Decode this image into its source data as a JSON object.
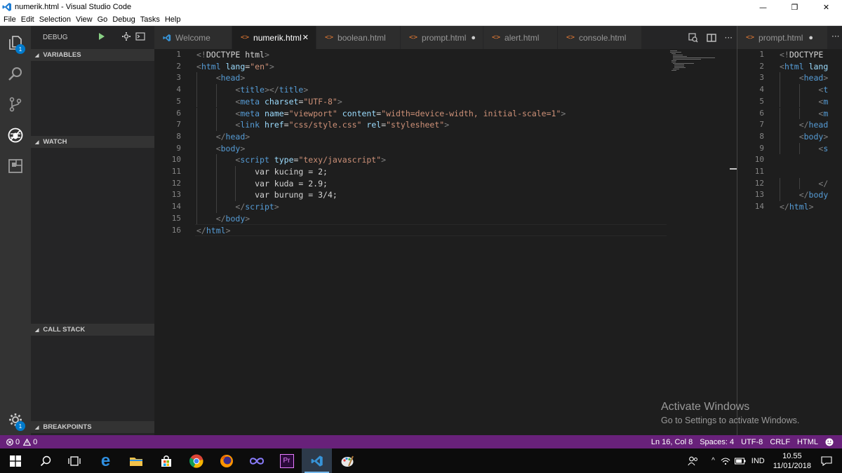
{
  "window": {
    "title": "numerik.html - Visual Studio Code",
    "controls": [
      "—",
      "❐",
      "✕"
    ]
  },
  "menu": [
    "File",
    "Edit",
    "Selection",
    "View",
    "Go",
    "Debug",
    "Tasks",
    "Help"
  ],
  "activity_bar": {
    "items": [
      "explorer-icon",
      "search-icon",
      "source-control-icon",
      "debug-icon",
      "extensions-icon"
    ],
    "explorer_badge": "1",
    "settings_badge": "1"
  },
  "sidebar": {
    "title": "DEBUG",
    "sections": {
      "variables": "VARIABLES",
      "watch": "WATCH",
      "call_stack": "CALL STACK",
      "breakpoints": "BREAKPOINTS"
    }
  },
  "tabs": [
    {
      "label": "Welcome",
      "icon": "vscode-icon",
      "active": false,
      "status": ""
    },
    {
      "label": "numerik.html",
      "icon": "<>",
      "active": true,
      "status": "✕"
    },
    {
      "label": "boolean.html",
      "icon": "<>",
      "active": false,
      "status": ""
    },
    {
      "label": "prompt.html",
      "icon": "<>",
      "active": false,
      "status": "●"
    },
    {
      "label": "alert.html",
      "icon": "<>",
      "active": false,
      "status": ""
    },
    {
      "label": "console.html",
      "icon": "<>",
      "active": false,
      "status": ""
    }
  ],
  "editor": {
    "lines": [
      {
        "n": "1",
        "indent": 0,
        "tokens": [
          [
            "br",
            "<!"
          ],
          [
            "txt",
            "DOCTYPE html"
          ],
          [
            "br",
            ">"
          ]
        ]
      },
      {
        "n": "2",
        "indent": 0,
        "tokens": [
          [
            "br",
            "<"
          ],
          [
            "tag",
            "html"
          ],
          [
            "txt",
            " "
          ],
          [
            "attr",
            "lang"
          ],
          [
            "txt",
            "="
          ],
          [
            "str",
            "\"en\""
          ],
          [
            "br",
            ">"
          ]
        ]
      },
      {
        "n": "3",
        "indent": 1,
        "tokens": [
          [
            "br",
            "<"
          ],
          [
            "tag",
            "head"
          ],
          [
            "br",
            ">"
          ]
        ]
      },
      {
        "n": "4",
        "indent": 2,
        "tokens": [
          [
            "br",
            "<"
          ],
          [
            "tag",
            "title"
          ],
          [
            "br",
            "></"
          ],
          [
            "tag",
            "title"
          ],
          [
            "br",
            ">"
          ]
        ]
      },
      {
        "n": "5",
        "indent": 2,
        "tokens": [
          [
            "br",
            "<"
          ],
          [
            "tag",
            "meta"
          ],
          [
            "txt",
            " "
          ],
          [
            "attr",
            "charset"
          ],
          [
            "txt",
            "="
          ],
          [
            "str",
            "\"UTF-8\""
          ],
          [
            "br",
            ">"
          ]
        ]
      },
      {
        "n": "6",
        "indent": 2,
        "tokens": [
          [
            "br",
            "<"
          ],
          [
            "tag",
            "meta"
          ],
          [
            "txt",
            " "
          ],
          [
            "attr",
            "name"
          ],
          [
            "txt",
            "="
          ],
          [
            "str",
            "\"viewport\""
          ],
          [
            "txt",
            " "
          ],
          [
            "attr",
            "content"
          ],
          [
            "txt",
            "="
          ],
          [
            "str",
            "\"width=device-width, initial-scale=1\""
          ],
          [
            "br",
            ">"
          ]
        ]
      },
      {
        "n": "7",
        "indent": 2,
        "tokens": [
          [
            "br",
            "<"
          ],
          [
            "tag",
            "link"
          ],
          [
            "txt",
            " "
          ],
          [
            "attr",
            "href"
          ],
          [
            "txt",
            "="
          ],
          [
            "str",
            "\"css/style.css\""
          ],
          [
            "txt",
            " "
          ],
          [
            "attr",
            "rel"
          ],
          [
            "txt",
            "="
          ],
          [
            "str",
            "\"stylesheet\""
          ],
          [
            "br",
            ">"
          ]
        ]
      },
      {
        "n": "8",
        "indent": 1,
        "tokens": [
          [
            "br",
            "</"
          ],
          [
            "tag",
            "head"
          ],
          [
            "br",
            ">"
          ]
        ]
      },
      {
        "n": "9",
        "indent": 1,
        "tokens": [
          [
            "br",
            "<"
          ],
          [
            "tag",
            "body"
          ],
          [
            "br",
            ">"
          ]
        ]
      },
      {
        "n": "10",
        "indent": 2,
        "tokens": [
          [
            "br",
            "<"
          ],
          [
            "tag",
            "script"
          ],
          [
            "txt",
            " "
          ],
          [
            "attr",
            "type"
          ],
          [
            "txt",
            "="
          ],
          [
            "str",
            "\"texy/javascript\""
          ],
          [
            "br",
            ">"
          ]
        ]
      },
      {
        "n": "11",
        "indent": 3,
        "tokens": [
          [
            "txt",
            "var kucing = 2;"
          ]
        ]
      },
      {
        "n": "12",
        "indent": 3,
        "tokens": [
          [
            "txt",
            "var kuda = 2.9;"
          ]
        ]
      },
      {
        "n": "13",
        "indent": 3,
        "tokens": [
          [
            "txt",
            "var burung = 3/4;"
          ]
        ]
      },
      {
        "n": "14",
        "indent": 2,
        "tokens": [
          [
            "br",
            "</"
          ],
          [
            "tag",
            "script"
          ],
          [
            "br",
            ">"
          ]
        ]
      },
      {
        "n": "15",
        "indent": 1,
        "tokens": [
          [
            "br",
            "</"
          ],
          [
            "tag",
            "body"
          ],
          [
            "br",
            ">"
          ]
        ]
      },
      {
        "n": "16",
        "indent": 0,
        "tokens": [
          [
            "br",
            "</"
          ],
          [
            "tag",
            "html"
          ],
          [
            "br",
            ">"
          ]
        ]
      }
    ]
  },
  "right_group": {
    "tab_label": "prompt.html",
    "tab_status": "●",
    "lines": [
      {
        "n": "1",
        "indent": 0,
        "tokens": [
          [
            "br",
            "<!"
          ],
          [
            "txt",
            "DOCTYPE"
          ]
        ]
      },
      {
        "n": "2",
        "indent": 0,
        "tokens": [
          [
            "br",
            "<"
          ],
          [
            "tag",
            "html"
          ],
          [
            "txt",
            " "
          ],
          [
            "attr",
            "lang"
          ]
        ]
      },
      {
        "n": "3",
        "indent": 1,
        "tokens": [
          [
            "br",
            "<"
          ],
          [
            "tag",
            "head"
          ],
          [
            "br",
            ">"
          ]
        ]
      },
      {
        "n": "4",
        "indent": 2,
        "tokens": [
          [
            "br",
            "<"
          ],
          [
            "tag",
            "t"
          ]
        ]
      },
      {
        "n": "5",
        "indent": 2,
        "tokens": [
          [
            "br",
            "<"
          ],
          [
            "tag",
            "m"
          ]
        ]
      },
      {
        "n": "6",
        "indent": 2,
        "tokens": [
          [
            "br",
            "<"
          ],
          [
            "tag",
            "m"
          ]
        ]
      },
      {
        "n": "7",
        "indent": 1,
        "tokens": [
          [
            "br",
            "</"
          ],
          [
            "tag",
            "head"
          ]
        ]
      },
      {
        "n": "8",
        "indent": 1,
        "tokens": [
          [
            "br",
            "<"
          ],
          [
            "tag",
            "body"
          ],
          [
            "br",
            ">"
          ]
        ]
      },
      {
        "n": "9",
        "indent": 2,
        "tokens": [
          [
            "br",
            "<"
          ],
          [
            "tag",
            "s"
          ]
        ]
      },
      {
        "n": "10",
        "indent": 0,
        "tokens": []
      },
      {
        "n": "11",
        "indent": 0,
        "tokens": []
      },
      {
        "n": "12",
        "indent": 2,
        "tokens": [
          [
            "br",
            "</"
          ]
        ]
      },
      {
        "n": "13",
        "indent": 1,
        "tokens": [
          [
            "br",
            "</"
          ],
          [
            "tag",
            "body"
          ]
        ]
      },
      {
        "n": "14",
        "indent": 0,
        "tokens": [
          [
            "br",
            "</"
          ],
          [
            "tag",
            "html"
          ],
          [
            "br",
            ">"
          ]
        ]
      }
    ]
  },
  "watermark": {
    "title": "Activate Windows",
    "subtitle": "Go to Settings to activate Windows."
  },
  "statusbar": {
    "errors": "0",
    "warnings": "0",
    "position": "Ln 16, Col 8",
    "spaces": "Spaces: 4",
    "encoding": "UTF-8",
    "eol": "CRLF",
    "language": "HTML",
    "color": "#68217a"
  },
  "taskbar": {
    "apps": [
      "windows-start-icon",
      "search-icon",
      "task-view-icon",
      "edge-icon",
      "file-explorer-icon",
      "store-icon",
      "chrome-icon",
      "firefox-icon",
      "infinity-icon",
      "premiere-icon",
      "vscode-icon",
      "paint-icon"
    ],
    "language": "IND",
    "time": "10.55",
    "date": "11/01/2018"
  }
}
